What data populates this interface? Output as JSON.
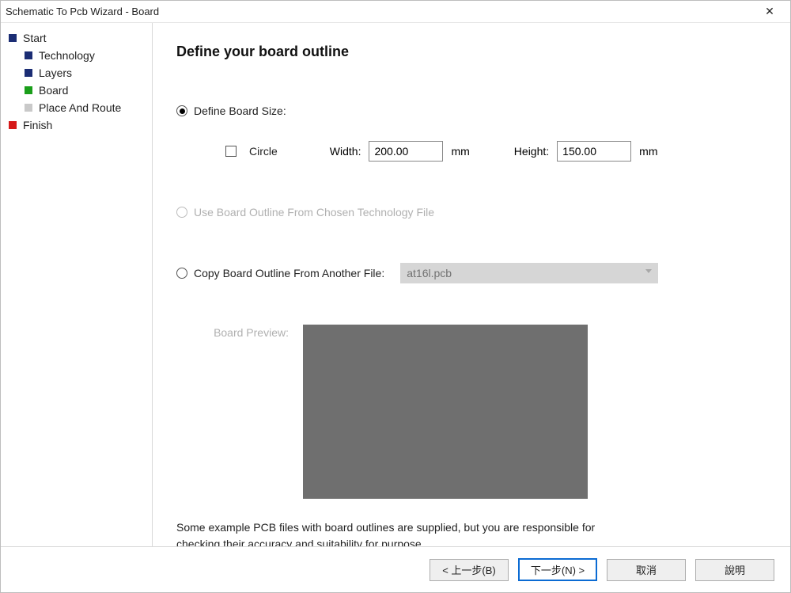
{
  "window": {
    "title": "Schematic To Pcb Wizard - Board"
  },
  "sidebar": {
    "steps": [
      {
        "label": "Start"
      },
      {
        "label": "Technology"
      },
      {
        "label": "Layers"
      },
      {
        "label": "Board"
      },
      {
        "label": "Place And Route"
      },
      {
        "label": "Finish"
      }
    ]
  },
  "main": {
    "heading": "Define your board outline",
    "opt_define": "Define Board Size:",
    "circle_label": "Circle",
    "width_label": "Width:",
    "width_value": "200.00",
    "width_unit": "mm",
    "height_label": "Height:",
    "height_value": "150.00",
    "height_unit": "mm",
    "opt_tech": "Use Board Outline From Chosen Technology File",
    "opt_copy": "Copy Board Outline From Another File:",
    "copy_file": "at16l.pcb",
    "preview_label": "Board Preview:",
    "note": "Some example PCB files with board outlines are supplied, but you are responsible for checking their accuracy and suitability for purpose."
  },
  "footer": {
    "back": "< 上一步(B)",
    "next": "下一步(N) >",
    "cancel": "取消",
    "help": "說明"
  }
}
